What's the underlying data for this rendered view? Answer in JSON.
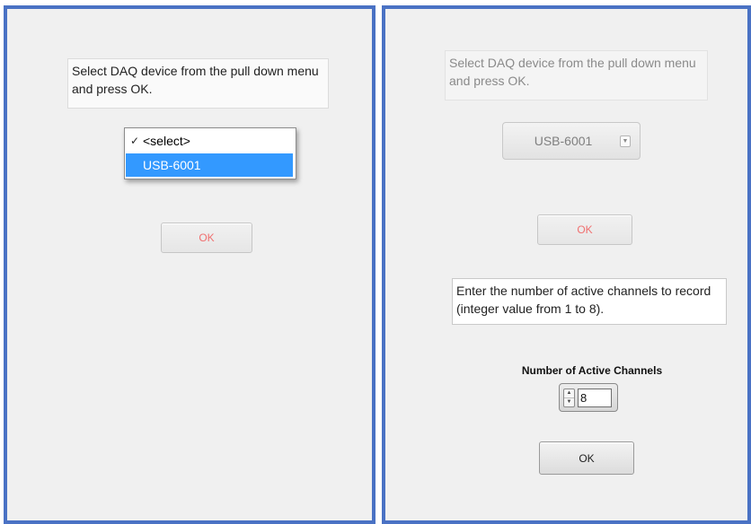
{
  "left": {
    "instruction": "Select DAQ device from the pull down menu and press OK.",
    "dropdown": {
      "items": [
        {
          "check": "✓",
          "label": "<select>"
        },
        {
          "check": "",
          "label": "USB-6001"
        }
      ],
      "highlighted_index": 1
    },
    "ok_label": "OK"
  },
  "right": {
    "instruction": "Select DAQ device from the pull down menu and press OK.",
    "device_selected": "USB-6001",
    "device_dropdown_icon": "dropdown-arrow-icon",
    "ok_label_1": "OK",
    "channels_instruction": "Enter the number of active channels to record (integer value from 1 to 8).",
    "channels_label": "Number of Active Channels",
    "channels_value": "8",
    "stepper_up": "▲",
    "stepper_down": "▼",
    "ok_label_2": "OK"
  },
  "colors": {
    "panel_border": "#4a72c4",
    "panel_bg": "#f0f0f0",
    "menu_highlight": "#3399ff",
    "disabled_ok_text": "#f07070"
  }
}
